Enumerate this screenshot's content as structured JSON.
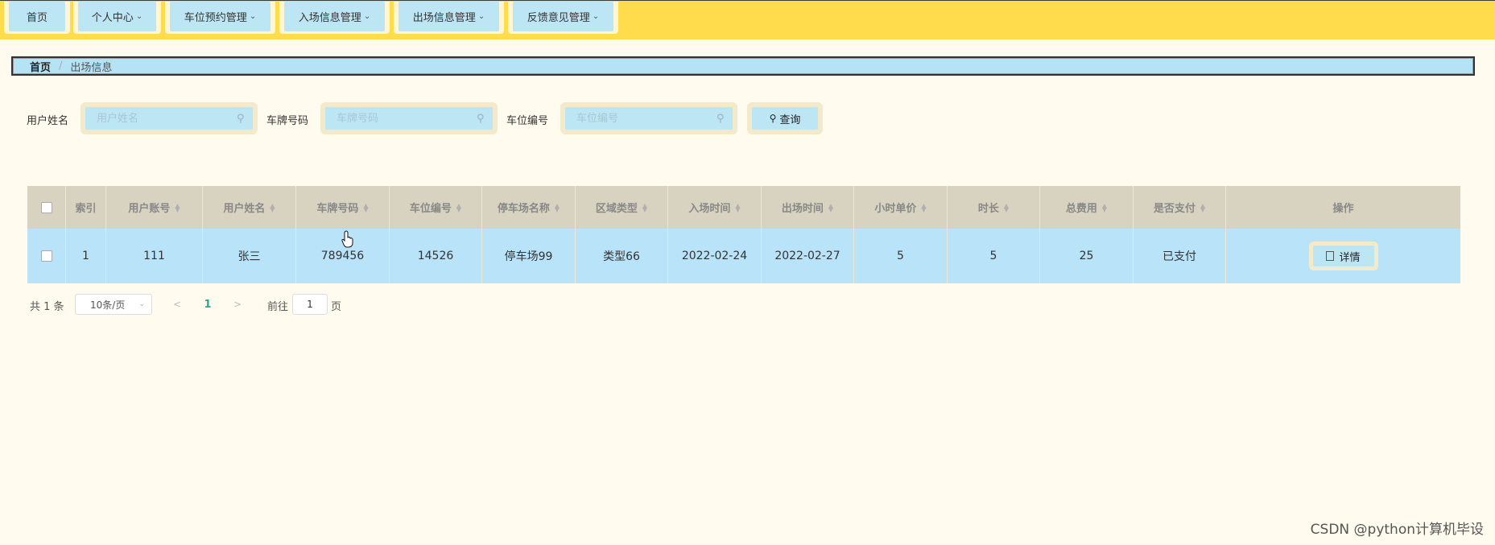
{
  "nav": [
    {
      "label": "首页",
      "dropdown": false
    },
    {
      "label": "个人中心",
      "dropdown": true
    },
    {
      "label": "车位预约管理",
      "dropdown": true
    },
    {
      "label": "入场信息管理",
      "dropdown": true
    },
    {
      "label": "出场信息管理",
      "dropdown": true
    },
    {
      "label": "反馈意见管理",
      "dropdown": true
    }
  ],
  "breadcrumb": {
    "home": "首页",
    "separator": "/",
    "current": "出场信息"
  },
  "search": {
    "fields": [
      {
        "label": "用户姓名",
        "placeholder": "用户姓名",
        "value": ""
      },
      {
        "label": "车牌号码",
        "placeholder": "车牌号码",
        "value": ""
      },
      {
        "label": "车位编号",
        "placeholder": "车位编号",
        "value": ""
      }
    ],
    "query_label": "查询"
  },
  "table": {
    "columns": [
      "",
      "索引",
      "用户账号",
      "用户姓名",
      "车牌号码",
      "车位编号",
      "停车场名称",
      "区域类型",
      "入场时间",
      "出场时间",
      "小时单价",
      "时长",
      "总费用",
      "是否支付",
      "操作"
    ],
    "sortable": [
      false,
      false,
      true,
      true,
      true,
      true,
      true,
      true,
      true,
      true,
      true,
      true,
      true,
      true,
      false
    ],
    "rows": [
      {
        "index": "1",
        "account": "111",
        "name": "张三",
        "plate": "789456",
        "spot": "14526",
        "lot": "停车场99",
        "area": "类型66",
        "in_time": "2022-02-24",
        "out_time": "2022-02-27",
        "unit_price": "5",
        "duration": "5",
        "total": "25",
        "paid": "已支付",
        "action": "详情"
      }
    ]
  },
  "pagination": {
    "total_text": "共 1 条",
    "page_size": "10条/页",
    "current_page": "1",
    "goto_prefix": "前往",
    "goto_value": "1",
    "goto_suffix": "页"
  },
  "watermark": "CSDN @python计算机毕设",
  "colors": {
    "nav_bg": "#fedc4b",
    "accent_blue": "#bde6f5",
    "page_bg": "#fffcef",
    "header_row": "#d8d3c1"
  }
}
